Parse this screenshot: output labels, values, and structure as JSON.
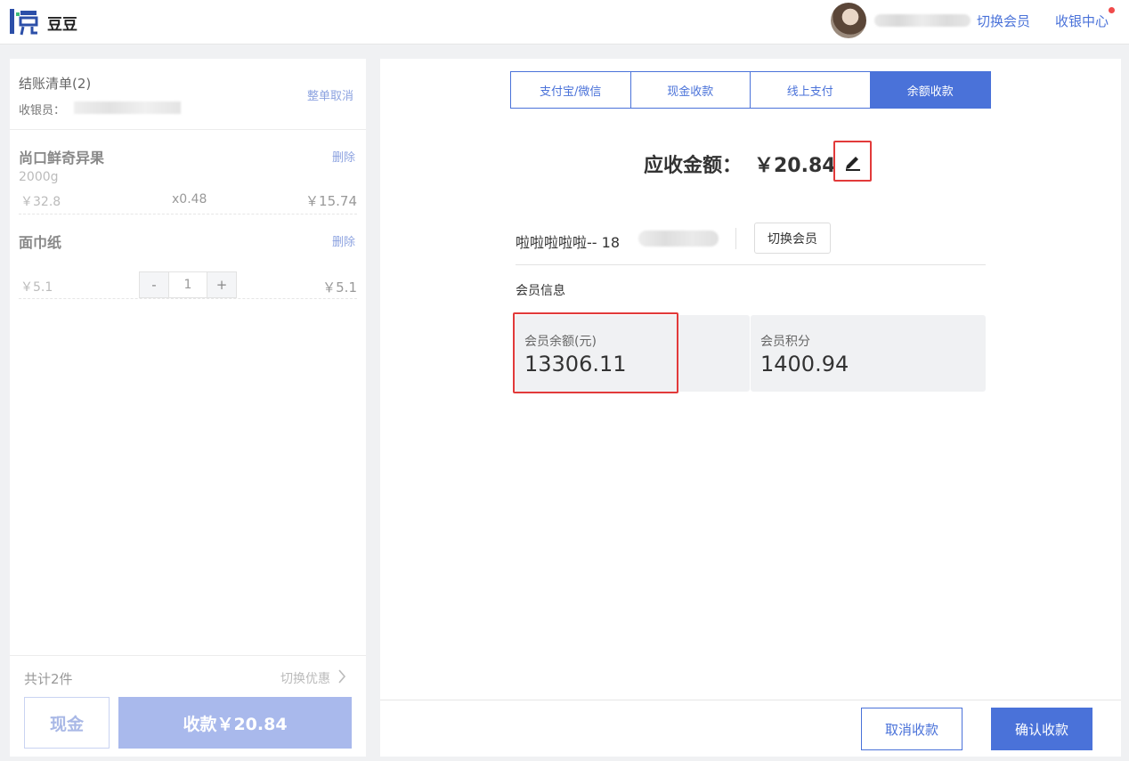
{
  "topbar": {
    "logo_char": "悦",
    "shop_name": "豆豆",
    "switch_member": "切换会员",
    "cashier_center": "收银中心"
  },
  "left": {
    "title": "结账清单(2)",
    "cashier_label": "收银员：",
    "cancel_all": "整单取消",
    "items": [
      {
        "name": "尚口鲜奇异果",
        "delete": "删除",
        "spec": "2000g",
        "price": "￥32.8",
        "qty": "x0.48",
        "total": "￥15.74"
      },
      {
        "name": "面巾纸",
        "delete": "删除",
        "spec": "",
        "price": "￥5.1",
        "stepper_minus": "-",
        "stepper_value": "1",
        "stepper_plus": "+",
        "total": "￥5.1"
      }
    ],
    "total_count": "共计2件",
    "switch_discount": "切换优惠",
    "cash_button": "现金",
    "collect_button": "收款￥20.84"
  },
  "right": {
    "tabs": [
      {
        "label": "支付宝/微信",
        "active": false
      },
      {
        "label": "现金收款",
        "active": false
      },
      {
        "label": "线上支付",
        "active": false
      },
      {
        "label": "余额收款",
        "active": true
      }
    ],
    "amount_label": "应收金额：",
    "amount_value": "￥20.84",
    "member_name": "啦啦啦啦啦-- 18",
    "switch_member_button": "切换会员",
    "member_info_title": "会员信息",
    "balance_label": "会员余额(元)",
    "balance_value": "13306.11",
    "points_label": "会员积分",
    "points_value": "1400.94",
    "cancel_button": "取消收款",
    "confirm_button": "确认收款"
  },
  "colors": {
    "accent": "#4a72d9",
    "highlight": "#e23a3a",
    "notify": "#f04a4a"
  }
}
